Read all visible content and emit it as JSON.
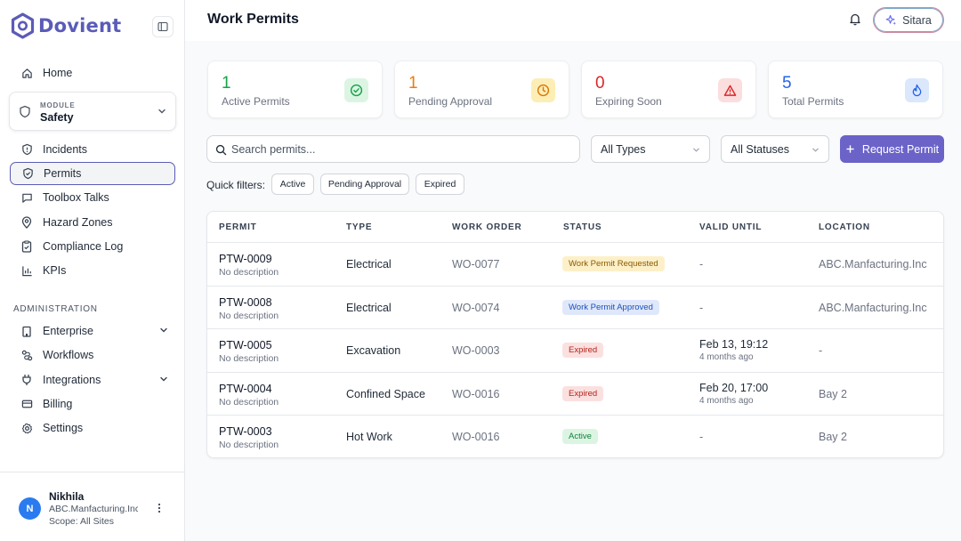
{
  "brand": {
    "name": "Dovient"
  },
  "sidebar": {
    "home": "Home",
    "module": {
      "label": "MODULE",
      "value": "Safety"
    },
    "items": [
      {
        "label": "Incidents",
        "icon": "shield-alert-icon"
      },
      {
        "label": "Permits",
        "icon": "shield-check-icon"
      },
      {
        "label": "Toolbox Talks",
        "icon": "message-square-icon"
      },
      {
        "label": "Hazard Zones",
        "icon": "map-pin-icon"
      },
      {
        "label": "Compliance Log",
        "icon": "clipboard-check-icon"
      },
      {
        "label": "KPIs",
        "icon": "bar-chart-icon"
      }
    ],
    "admin_section": "ADMINISTRATION",
    "admin_items": [
      {
        "label": "Enterprise",
        "icon": "building-icon"
      },
      {
        "label": "Workflows",
        "icon": "workflow-icon"
      },
      {
        "label": "Integrations",
        "icon": "plug-icon"
      },
      {
        "label": "Billing",
        "icon": "credit-card-icon"
      },
      {
        "label": "Settings",
        "icon": "gear-icon"
      }
    ],
    "user": {
      "initial": "N",
      "name": "Nikhila",
      "org": "ABC.Manfacturing.Inc",
      "scope": "Scope: All Sites"
    }
  },
  "header": {
    "title": "Work Permits",
    "assistant": "Sitara"
  },
  "stats": [
    {
      "value": "1",
      "label": "Active Permits",
      "color": "#16a34a"
    },
    {
      "value": "1",
      "label": "Pending Approval",
      "color": "#ea7c12"
    },
    {
      "value": "0",
      "label": "Expiring Soon",
      "color": "#dc2626"
    },
    {
      "value": "5",
      "label": "Total Permits",
      "color": "#2563eb"
    }
  ],
  "filters": {
    "search_placeholder": "Search permits...",
    "type_select": "All Types",
    "status_select": "All Statuses",
    "request_button": "Request Permit",
    "quick_label": "Quick filters:",
    "chips": [
      "Active",
      "Pending Approval",
      "Expired"
    ]
  },
  "table": {
    "headers": [
      "PERMIT",
      "TYPE",
      "WORK ORDER",
      "STATUS",
      "VALID UNTIL",
      "LOCATION"
    ],
    "rows": [
      {
        "id": "PTW-0009",
        "desc": "No description",
        "type": "Electrical",
        "wo": "WO-0077",
        "status": "Work Permit Requested",
        "valid": "-",
        "valid_sub": "",
        "location": "ABC.Manfacturing.Inc"
      },
      {
        "id": "PTW-0008",
        "desc": "No description",
        "type": "Electrical",
        "wo": "WO-0074",
        "status": "Work Permit Approved",
        "valid": "-",
        "valid_sub": "",
        "location": "ABC.Manfacturing.Inc"
      },
      {
        "id": "PTW-0005",
        "desc": "No description",
        "type": "Excavation",
        "wo": "WO-0003",
        "status": "Expired",
        "valid": "Feb 13, 19:12",
        "valid_sub": "4 months ago",
        "location": "-"
      },
      {
        "id": "PTW-0004",
        "desc": "No description",
        "type": "Confined Space",
        "wo": "WO-0016",
        "status": "Expired",
        "valid": "Feb 20, 17:00",
        "valid_sub": "4 months ago",
        "location": "Bay 2"
      },
      {
        "id": "PTW-0003",
        "desc": "No description",
        "type": "Hot Work",
        "wo": "WO-0016",
        "status": "Active",
        "valid": "-",
        "valid_sub": "",
        "location": "Bay 2"
      }
    ]
  }
}
